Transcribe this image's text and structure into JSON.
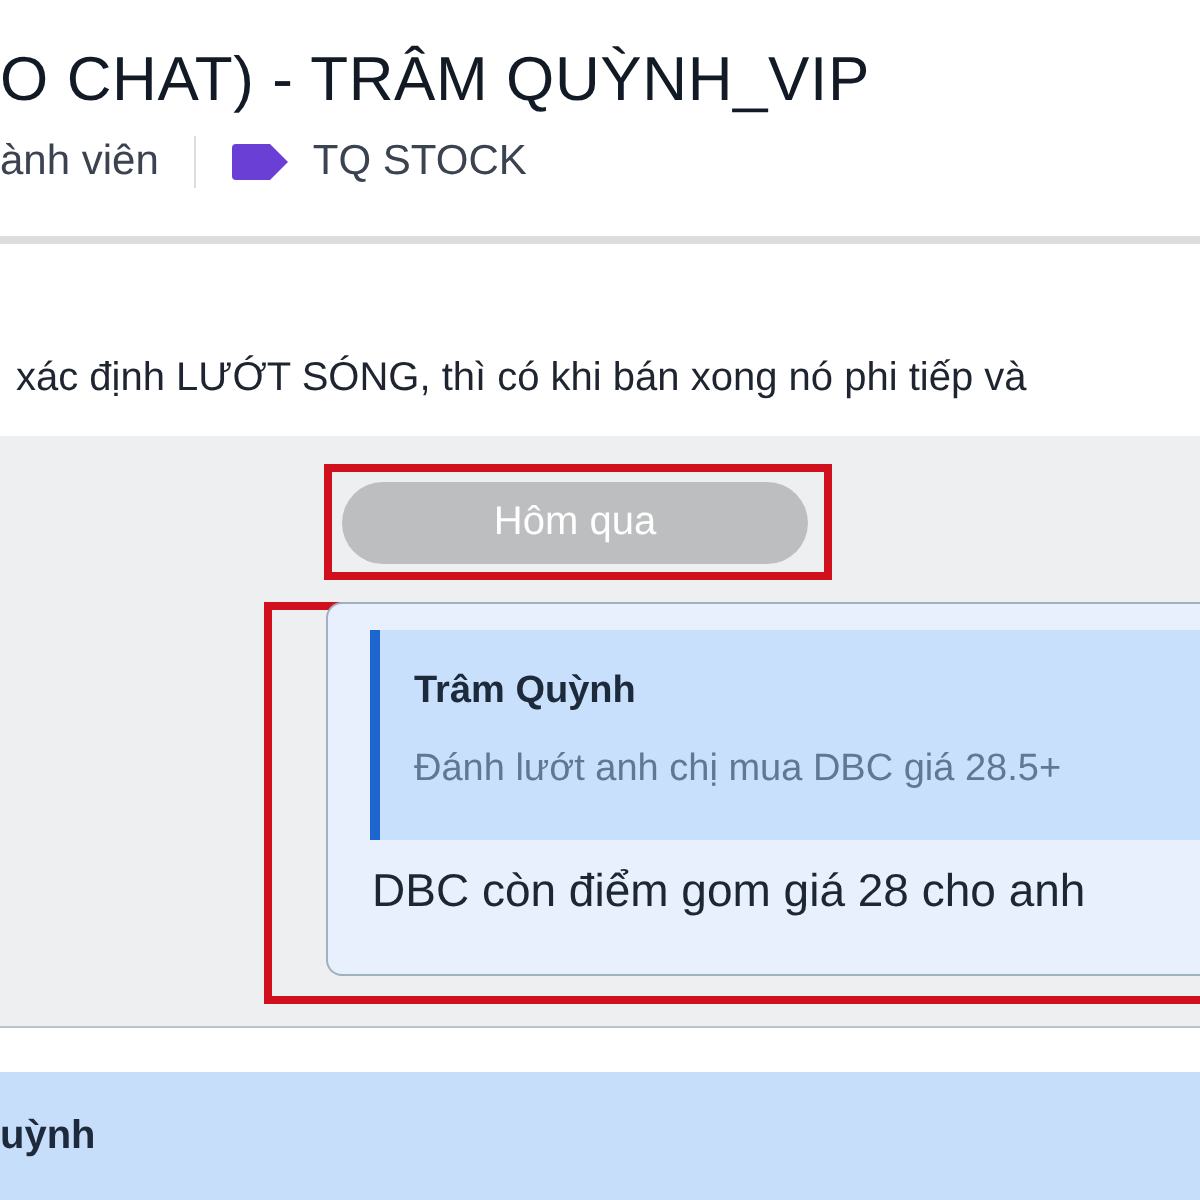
{
  "header": {
    "title": "O CHAT) - TRÂM QUỲNH_VIP",
    "members": "ành viên",
    "tag": {
      "label": "TQ STOCK",
      "color": "#6a3fd6"
    }
  },
  "pinned": {
    "text": "xác định LƯỚT SÓNG, thì có khi bán xong nó phi tiếp và"
  },
  "date_divider": {
    "label": "Hôm qua",
    "highlighted": true
  },
  "message": {
    "highlighted": true,
    "quote": {
      "author": "Trâm Quỳnh",
      "text": "Đánh lướt anh chị mua DBC giá 28.5+"
    },
    "text": "DBC còn điểm gom giá 28 cho anh"
  },
  "reply_bar": {
    "author": "uỳnh"
  }
}
